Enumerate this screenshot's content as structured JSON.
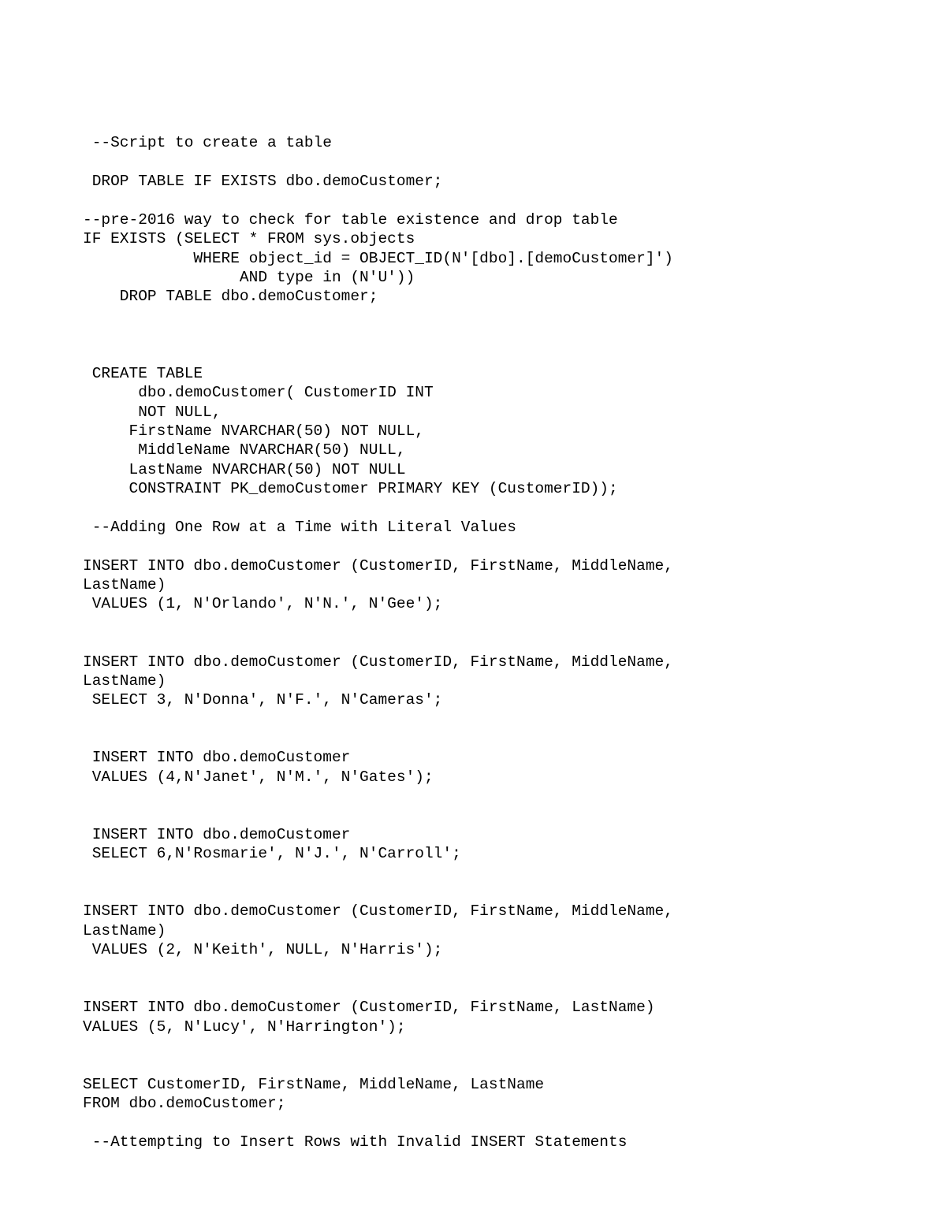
{
  "code": {
    "l01": " --Script to create a table",
    "l02": "",
    "l03": " DROP TABLE IF EXISTS dbo.demoCustomer;",
    "l04": "",
    "l05": "--pre-2016 way to check for table existence and drop table",
    "l06": "IF EXISTS (SELECT * FROM sys.objects",
    "l07": "            WHERE object_id = OBJECT_ID(N'[dbo].[demoCustomer]')",
    "l08": "                 AND type in (N'U'))",
    "l09": "    DROP TABLE dbo.demoCustomer;",
    "l10": "",
    "l11": "",
    "l12": "",
    "l13": " CREATE TABLE",
    "l14": "      dbo.demoCustomer( CustomerID INT",
    "l15": "      NOT NULL,",
    "l16": "     FirstName NVARCHAR(50) NOT NULL,",
    "l17": "      MiddleName NVARCHAR(50) NULL,",
    "l18": "     LastName NVARCHAR(50) NOT NULL",
    "l19": "     CONSTRAINT PK_demoCustomer PRIMARY KEY (CustomerID));",
    "l20": "",
    "l21": " --Adding One Row at a Time with Literal Values",
    "l22": "",
    "l23": "INSERT INTO dbo.demoCustomer (CustomerID, FirstName, MiddleName,",
    "l24": "LastName)",
    "l25": " VALUES (1, N'Orlando', N'N.', N'Gee');",
    "l26": "",
    "l27": "",
    "l28": "INSERT INTO dbo.demoCustomer (CustomerID, FirstName, MiddleName,",
    "l29": "LastName)",
    "l30": " SELECT 3, N'Donna', N'F.', N'Cameras';",
    "l31": "",
    "l32": "",
    "l33": " INSERT INTO dbo.demoCustomer",
    "l34": " VALUES (4,N'Janet', N'M.', N'Gates');",
    "l35": "",
    "l36": "",
    "l37": " INSERT INTO dbo.demoCustomer",
    "l38": " SELECT 6,N'Rosmarie', N'J.', N'Carroll';",
    "l39": "",
    "l40": "",
    "l41": "INSERT INTO dbo.demoCustomer (CustomerID, FirstName, MiddleName,",
    "l42": "LastName)",
    "l43": " VALUES (2, N'Keith', NULL, N'Harris');",
    "l44": "",
    "l45": "",
    "l46": "INSERT INTO dbo.demoCustomer (CustomerID, FirstName, LastName)",
    "l47": "VALUES (5, N'Lucy', N'Harrington');",
    "l48": "",
    "l49": "",
    "l50": "SELECT CustomerID, FirstName, MiddleName, LastName",
    "l51": "FROM dbo.demoCustomer;",
    "l52": "",
    "l53": " --Attempting to Insert Rows with Invalid INSERT Statements"
  }
}
